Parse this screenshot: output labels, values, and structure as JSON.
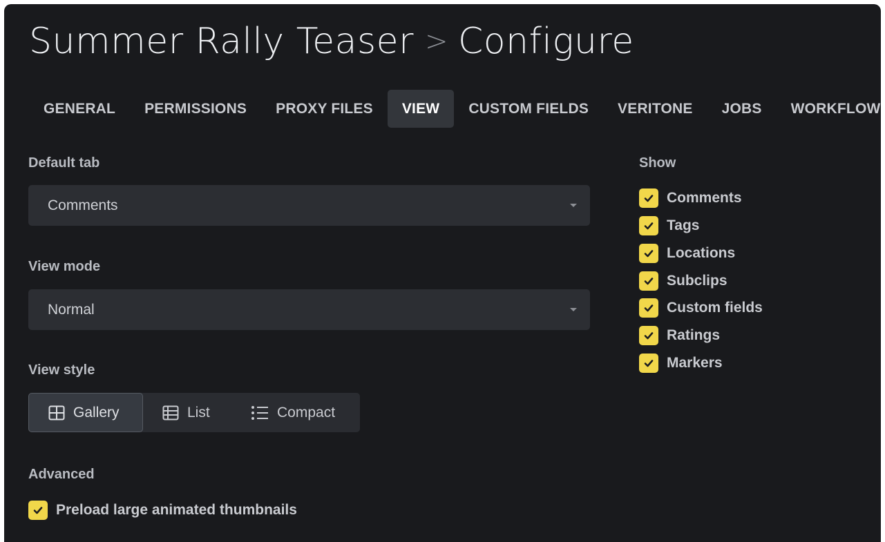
{
  "header": {
    "project_name": "Summer Rally Teaser",
    "separator": ">",
    "page_name": "Configure"
  },
  "tabs": [
    {
      "label": "GENERAL",
      "active": false
    },
    {
      "label": "PERMISSIONS",
      "active": false
    },
    {
      "label": "PROXY FILES",
      "active": false
    },
    {
      "label": "VIEW",
      "active": true
    },
    {
      "label": "CUSTOM FIELDS",
      "active": false
    },
    {
      "label": "VERITONE",
      "active": false
    },
    {
      "label": "JOBS",
      "active": false
    },
    {
      "label": "WORKFLOW",
      "active": false
    }
  ],
  "default_tab": {
    "label": "Default tab",
    "value": "Comments"
  },
  "view_mode": {
    "label": "View mode",
    "value": "Normal"
  },
  "view_style": {
    "label": "View style",
    "options": [
      {
        "label": "Gallery",
        "icon": "grid-icon",
        "selected": true
      },
      {
        "label": "List",
        "icon": "table-icon",
        "selected": false
      },
      {
        "label": "Compact",
        "icon": "compact-list-icon",
        "selected": false
      }
    ]
  },
  "advanced": {
    "label": "Advanced",
    "preload_label": "Preload large animated thumbnails",
    "preload_checked": true
  },
  "show": {
    "label": "Show",
    "items": [
      {
        "label": "Comments",
        "checked": true
      },
      {
        "label": "Tags",
        "checked": true
      },
      {
        "label": "Locations",
        "checked": true
      },
      {
        "label": "Subclips",
        "checked": true
      },
      {
        "label": "Custom fields",
        "checked": true
      },
      {
        "label": "Ratings",
        "checked": true
      },
      {
        "label": "Markers",
        "checked": true
      }
    ]
  },
  "colors": {
    "background": "#191a1d",
    "field": "#2c2e33",
    "active_tab": "#33363b",
    "checkbox": "#f1d74a",
    "checkmark": "#1c1d20"
  }
}
